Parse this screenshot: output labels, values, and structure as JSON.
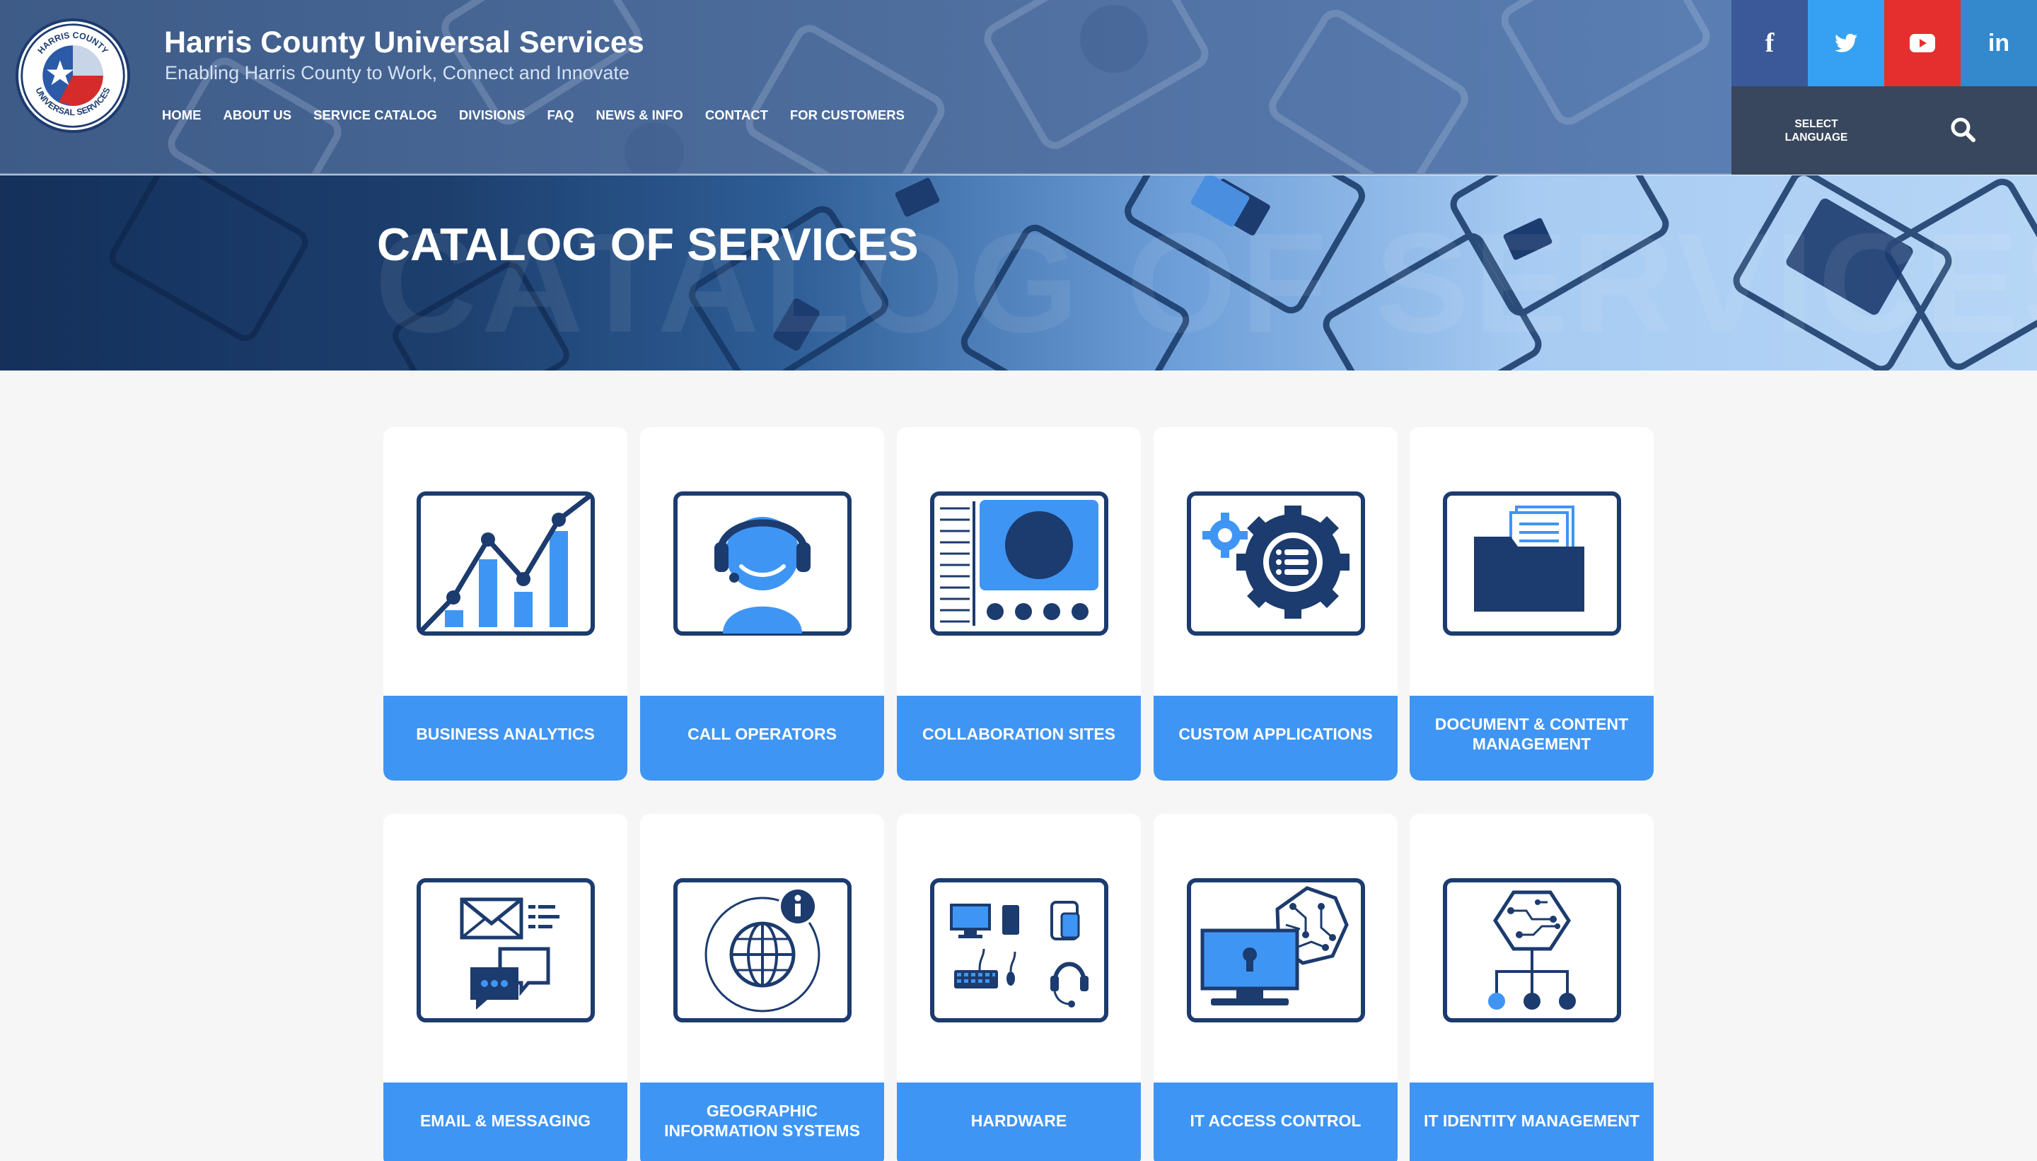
{
  "header": {
    "title": "Harris County Universal Services",
    "tagline": "Enabling Harris County to Work, Connect and Innovate",
    "logo": {
      "top_text": "HARRIS COUNTY",
      "bottom_text": "UNIVERSAL SERVICES"
    },
    "nav": [
      "HOME",
      "ABOUT US",
      "SERVICE CATALOG",
      "DIVISIONS",
      "FAQ",
      "NEWS & INFO",
      "CONTACT",
      "FOR CUSTOMERS"
    ],
    "social": [
      {
        "name": "facebook",
        "glyph": "f",
        "color": "#3b5998"
      },
      {
        "name": "twitter",
        "glyph": "twitter-bird-icon",
        "color": "#36a1f2"
      },
      {
        "name": "youtube",
        "glyph": "youtube-play-icon",
        "color": "#e52e2e"
      },
      {
        "name": "linkedin",
        "glyph": "in",
        "color": "#3389cc"
      }
    ],
    "language": {
      "line1": "SELECT",
      "line2": "LANGUAGE"
    }
  },
  "hero": {
    "title": "CATALOG OF SERVICES"
  },
  "colors": {
    "navy": "#1c3b6e",
    "accent": "#3f95f3",
    "header": "#4e6e9e",
    "lang_bar": "#38475d"
  },
  "services": [
    {
      "label": "BUSINESS ANALYTICS",
      "icon": "bar-chart-icon"
    },
    {
      "label": "CALL OPERATORS",
      "icon": "headset-operator-icon"
    },
    {
      "label": "COLLABORATION SITES",
      "icon": "collaboration-screen-icon"
    },
    {
      "label": "CUSTOM APPLICATIONS",
      "icon": "gear-list-icon"
    },
    {
      "label": "DOCUMENT & CONTENT MANAGEMENT",
      "icon": "folder-documents-icon"
    },
    {
      "label": "EMAIL & MESSAGING",
      "icon": "email-chat-icon"
    },
    {
      "label": "GEOGRAPHIC INFORMATION SYSTEMS",
      "icon": "globe-info-icon"
    },
    {
      "label": "HARDWARE",
      "icon": "devices-icon"
    },
    {
      "label": "IT ACCESS CONTROL",
      "icon": "monitor-lock-icon"
    },
    {
      "label": "IT IDENTITY MANAGEMENT",
      "icon": "network-hierarchy-icon"
    }
  ]
}
